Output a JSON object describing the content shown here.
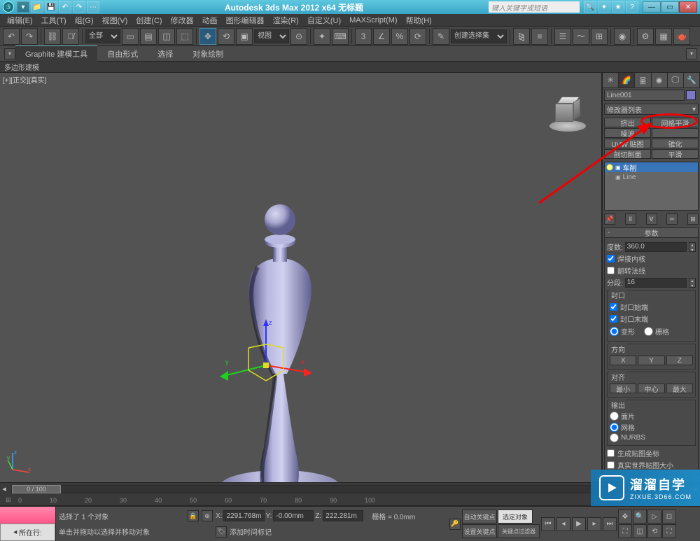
{
  "titlebar": {
    "title": "Autodesk 3ds Max 2012 x64   无标题",
    "search_placeholder": "键入关键字或短语"
  },
  "menu": {
    "items": [
      "编辑(E)",
      "工具(T)",
      "组(G)",
      "视图(V)",
      "创建(C)",
      "修改器",
      "动画",
      "图形编辑器",
      "渲染(R)",
      "自定义(U)",
      "MAXScript(M)",
      "帮助(H)"
    ]
  },
  "maintoolbar": {
    "select_filter": "全部",
    "view_label": "视图",
    "named_sel": "创建选择集"
  },
  "ribbon": {
    "tabs": [
      "Graphite 建模工具",
      "自由形式",
      "选择",
      "对象绘制"
    ],
    "sub": "多边形建模"
  },
  "viewport": {
    "label": "[+][正交][真实]"
  },
  "cmdpanel": {
    "obj_name": "Line001",
    "modifier_list": "修改器列表",
    "mod_buttons": [
      "挤出",
      "网格平滑",
      "噪波",
      "",
      "UVW 贴图",
      "锥化",
      "剖切削面",
      "平滑"
    ],
    "stack": [
      {
        "label": "车削",
        "selected": true,
        "expandable": true
      },
      {
        "label": "Line",
        "selected": false,
        "expandable": true
      }
    ],
    "params": {
      "title": "参数",
      "degrees_label": "度数:",
      "degrees": "360.0",
      "weld_core": "焊接内核",
      "flip_normals": "翻转法线",
      "segments_label": "分段:",
      "segments": "16",
      "capping": {
        "title": "封口",
        "cap_start": "封口始端",
        "cap_end": "封口末端",
        "morph": "变形",
        "grid": "栅格"
      },
      "direction": {
        "title": "方向",
        "x": "X",
        "y": "Y",
        "z": "Z"
      },
      "align": {
        "title": "对齐",
        "min": "最小",
        "center": "中心",
        "max": "最大"
      },
      "output": {
        "title": "输出",
        "patch": "面片",
        "mesh": "网格",
        "nurbs": "NURBS"
      },
      "gen_mapping": "生成贴图坐标",
      "real_world": "真实世界贴图大小"
    }
  },
  "timeline": {
    "pos": "0 / 100"
  },
  "ruler": [
    "0",
    "10",
    "20",
    "30",
    "40",
    "50",
    "60",
    "70",
    "80",
    "90",
    "100"
  ],
  "status": {
    "location_label": "所在行:",
    "sel_text": "选择了 1 个对象",
    "prompt": "单击并拖动以选择并移动对象",
    "x": "2291.768m",
    "y": "-0.00mm",
    "z": "222.281m",
    "grid": "栅格 = 0.0mm",
    "add_time": "添加时间标记",
    "auto_key": "自动关键点",
    "selected": "选定对象",
    "set_key": "设置关键点",
    "key_filters": "关键点过滤器"
  },
  "watermark": {
    "big": "溜溜自学",
    "small": "ZIXUE.3D66.COM"
  }
}
